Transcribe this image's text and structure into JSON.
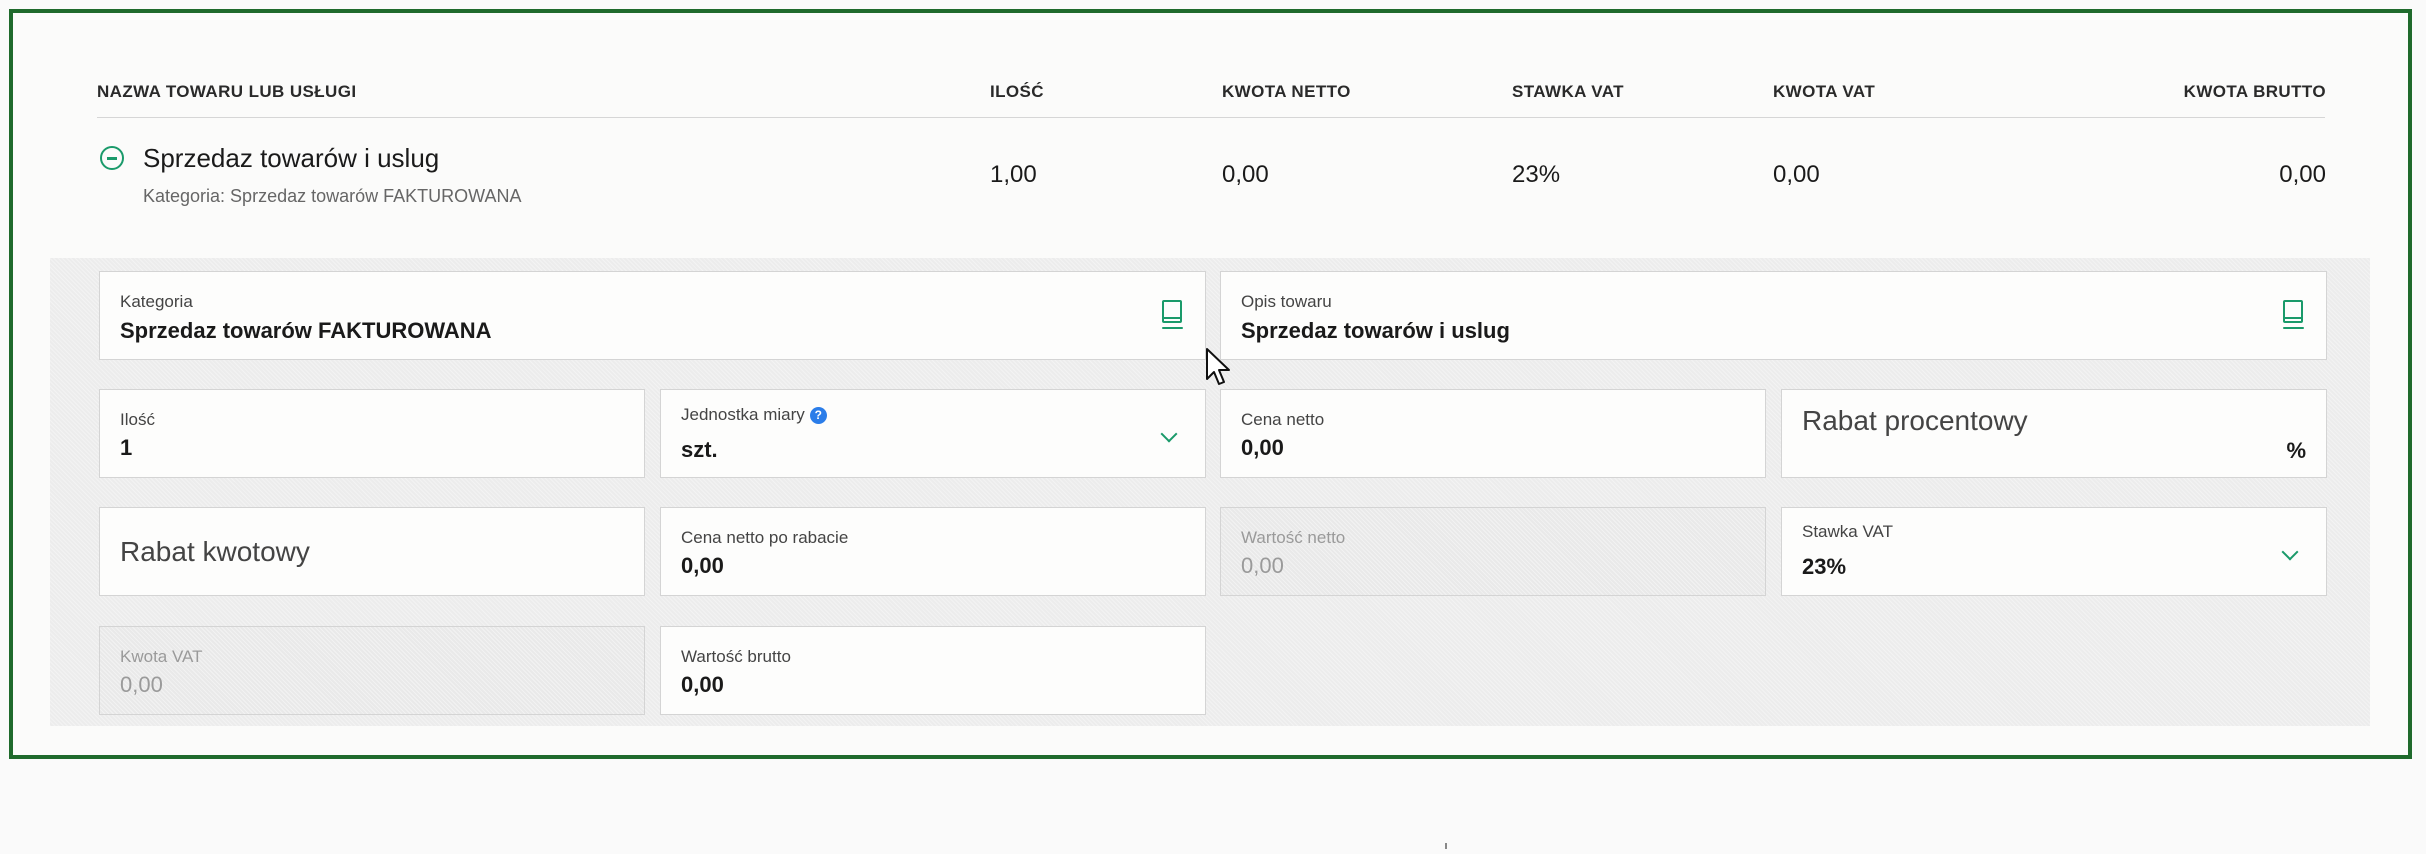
{
  "table": {
    "headers": {
      "name": "NAZWA TOWARU LUB USŁUGI",
      "qty": "ILOŚĆ",
      "net": "KWOTA NETTO",
      "vat_rate": "STAWKA VAT",
      "vat_amount": "KWOTA VAT",
      "gross": "KWOTA BRUTTO"
    },
    "row": {
      "title": "Sprzedaz towarów i uslug",
      "subtitle": "Kategoria: Sprzedaz towarów FAKTUROWANA",
      "qty": "1,00",
      "net": "0,00",
      "vat_rate": "23%",
      "vat_amount": "0,00",
      "gross": "0,00"
    }
  },
  "form": {
    "kategoria": {
      "label": "Kategoria",
      "value": "Sprzedaz towarów FAKTUROWANA"
    },
    "opis": {
      "label": "Opis towaru",
      "value": "Sprzedaz towarów i uslug"
    },
    "ilosc": {
      "label": "Ilość",
      "value": "1"
    },
    "jednostka": {
      "label": "Jednostka miary",
      "value": "szt.",
      "help": "?"
    },
    "cena_netto": {
      "label": "Cena netto",
      "value": "0,00"
    },
    "rabat_procentowy": {
      "placeholder": "Rabat procentowy",
      "suffix": "%"
    },
    "rabat_kwotowy": {
      "placeholder": "Rabat kwotowy"
    },
    "cena_po_rabacie": {
      "label": "Cena netto po rabacie",
      "value": "0,00"
    },
    "wartosc_netto": {
      "label": "Wartość netto",
      "value": "0,00"
    },
    "stawka_vat": {
      "label": "Stawka VAT",
      "value": "23%"
    },
    "kwota_vat": {
      "label": "Kwota VAT",
      "value": "0,00"
    },
    "wartosc_brutto": {
      "label": "Wartość brutto",
      "value": "0,00"
    }
  },
  "colors": {
    "accent": "#1a9a6a",
    "frame": "#1f6a2c",
    "help": "#2b7de9"
  },
  "icons": [
    "collapse-icon",
    "book-icon",
    "chevron-down-icon",
    "help-icon",
    "mouse-cursor-icon"
  ]
}
